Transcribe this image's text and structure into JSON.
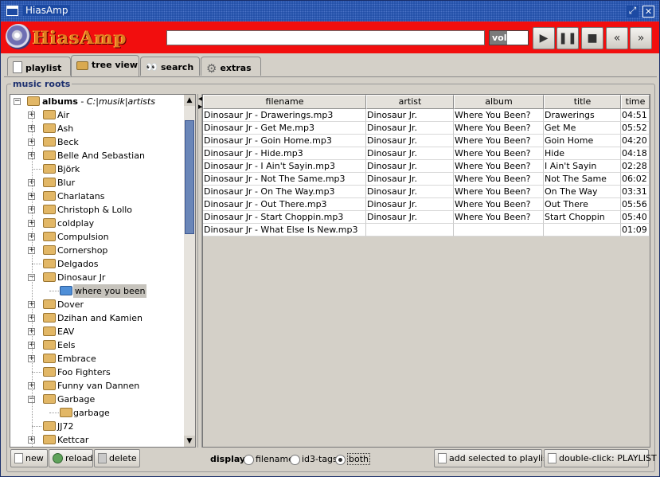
{
  "window": {
    "title": "HiasAmp"
  },
  "player": {
    "logo_text": "HiasAmp",
    "display_text": "",
    "volume_label": "volume",
    "volume_level": 0.45,
    "buttons": [
      "play",
      "pause",
      "stop",
      "previous",
      "next"
    ]
  },
  "tabs": [
    {
      "label": "playlist",
      "icon": "page-icon"
    },
    {
      "label": "tree view",
      "icon": "folder-icon"
    },
    {
      "label": "search",
      "icon": "eyes-icon"
    },
    {
      "label": "extras",
      "icon": "gear-icon"
    }
  ],
  "active_tab": "tree view",
  "music_roots_label": "music roots",
  "tree": {
    "root_label": "albums",
    "root_path": "C:|musik|artists",
    "items": [
      {
        "label": "Air",
        "expander": "+"
      },
      {
        "label": "Ash",
        "expander": "+"
      },
      {
        "label": "Beck",
        "expander": "+"
      },
      {
        "label": "Belle And Sebastian",
        "expander": "+"
      },
      {
        "label": "Björk",
        "expander": ""
      },
      {
        "label": "Blur",
        "expander": "+"
      },
      {
        "label": "Charlatans",
        "expander": "+"
      },
      {
        "label": "Christoph & Lollo",
        "expander": "+"
      },
      {
        "label": "coldplay",
        "expander": "+"
      },
      {
        "label": "Compulsion",
        "expander": "+"
      },
      {
        "label": "Cornershop",
        "expander": "+"
      },
      {
        "label": "Delgados",
        "expander": ""
      },
      {
        "label": "Dinosaur Jr",
        "expander": "-"
      },
      {
        "label": "where you been",
        "child": true,
        "selected": true
      },
      {
        "label": "Dover",
        "expander": "+"
      },
      {
        "label": "Dzihan and Kamien",
        "expander": "+"
      },
      {
        "label": "EAV",
        "expander": "+"
      },
      {
        "label": "Eels",
        "expander": "+"
      },
      {
        "label": "Embrace",
        "expander": "+"
      },
      {
        "label": "Foo Fighters",
        "expander": ""
      },
      {
        "label": "Funny van Dannen",
        "expander": "+"
      },
      {
        "label": "Garbage",
        "expander": "-"
      },
      {
        "label": "garbage",
        "child": true,
        "selected": false
      },
      {
        "label": "JJ72",
        "expander": ""
      },
      {
        "label": "Kettcar",
        "expander": "+"
      }
    ]
  },
  "table": {
    "columns": [
      "filename",
      "artist",
      "album",
      "title",
      "time"
    ],
    "rows": [
      [
        "Dinosaur Jr - Drawerings.mp3",
        "Dinosaur Jr.",
        "Where You Been?",
        "Drawerings",
        "04:51"
      ],
      [
        "Dinosaur Jr - Get Me.mp3",
        "Dinosaur Jr.",
        "Where You Been?",
        "Get Me",
        "05:52"
      ],
      [
        "Dinosaur Jr - Goin Home.mp3",
        "Dinosaur Jr.",
        "Where You Been?",
        "Goin Home",
        "04:20"
      ],
      [
        "Dinosaur Jr - Hide.mp3",
        "Dinosaur Jr.",
        "Where You Been?",
        "Hide",
        "04:18"
      ],
      [
        "Dinosaur Jr - I Ain't Sayin.mp3",
        "Dinosaur Jr.",
        "Where You Been?",
        "I Ain't Sayin",
        "02:28"
      ],
      [
        "Dinosaur Jr - Not The Same.mp3",
        "Dinosaur Jr.",
        "Where You Been?",
        "Not The Same",
        "06:02"
      ],
      [
        "Dinosaur Jr - On The Way.mp3",
        "Dinosaur Jr.",
        "Where You Been?",
        "On The Way",
        "03:31"
      ],
      [
        "Dinosaur Jr - Out There.mp3",
        "Dinosaur Jr.",
        "Where You Been?",
        "Out There",
        "05:56"
      ],
      [
        "Dinosaur Jr - Start Choppin.mp3",
        "Dinosaur Jr.",
        "Where You Been?",
        "Start Choppin",
        "05:40"
      ],
      [
        "Dinosaur Jr - What Else Is New.mp3",
        "",
        "",
        "",
        "01:09"
      ]
    ]
  },
  "tree_buttons": {
    "new": "new",
    "reload": "reload",
    "delete": "delete"
  },
  "display_options": {
    "label": "display",
    "options": [
      "filename",
      "id3-tags",
      "both"
    ],
    "selected": "both"
  },
  "actions": {
    "add_selected": "add selected to playlist",
    "double_click": "double-click: PLAYLIST"
  }
}
